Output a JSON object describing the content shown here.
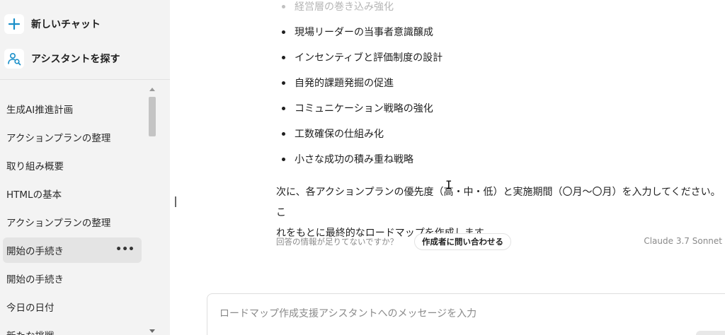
{
  "sidebar": {
    "new_chat_label": "新しいチャット",
    "find_assistant_label": "アシスタントを探す",
    "history": [
      {
        "label": "生成AI推進計画"
      },
      {
        "label": "アクションプランの整理"
      },
      {
        "label": "取り組み概要"
      },
      {
        "label": "HTMLの基本"
      },
      {
        "label": "アクションプランの整理"
      },
      {
        "label": "開始の手続き",
        "active": true,
        "more": "•••"
      },
      {
        "label": "開始の手続き"
      },
      {
        "label": "今日の日付"
      },
      {
        "label": "新たな挑戦"
      }
    ]
  },
  "message": {
    "bullets": [
      "経営層の巻き込み強化",
      "現場リーダーの当事者意識醸成",
      "インセンティブと評価制度の設計",
      "自発的課題発掘の促進",
      "コミュニケーション戦略の強化",
      "工数確保の仕組み化",
      "小さな成功の積み重ね戦略"
    ],
    "paragraph_line1": "次に、各アクションプランの優先度（高・中・低）と実施期間（〇月〜〇月）を入力してください。こ",
    "paragraph_line2": "れをもとに最終的なロードマップを作成します。",
    "feedback_question": "回答の情報が足りてないですか？",
    "contact_button": "作成者に問い合わせる",
    "model_name": "Claude 3.7 Sonnet"
  },
  "composer": {
    "placeholder": "ロードマップ作成支援アシスタントへのメッセージを入力"
  },
  "colors": {
    "accent": "#1a8fc9",
    "sidebar_bg": "#f3f3f3",
    "active_item_bg": "#e4e4e4"
  },
  "icons": {
    "new_chat": "plus-icon",
    "find_assistant": "person-search-icon",
    "more": "more-dots-icon"
  }
}
